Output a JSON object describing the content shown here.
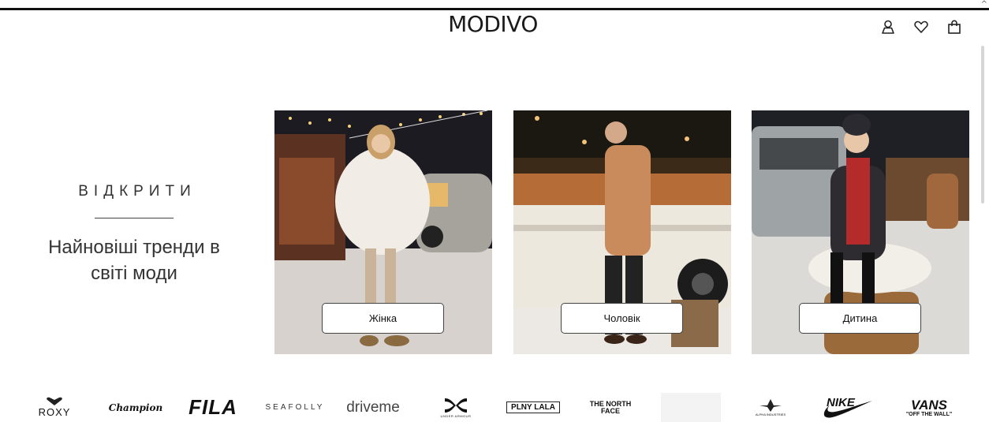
{
  "header": {
    "logo": "MODIVO",
    "icons": [
      "user-icon",
      "heart-icon",
      "bag-icon"
    ]
  },
  "promo": {
    "kicker": "ВІДКРИТИ",
    "headline_line1": "Найновіші тренди в",
    "headline_line2": "світі моди"
  },
  "categories": [
    {
      "label": "Жінка"
    },
    {
      "label": "Чоловік"
    },
    {
      "label": "Дитина"
    }
  ],
  "brands": [
    {
      "name": "ROXY"
    },
    {
      "name": "Champion"
    },
    {
      "name": "FILA"
    },
    {
      "name": "SEAFOLLY"
    },
    {
      "name": "driveme"
    },
    {
      "name": "UNDER ARMOUR"
    },
    {
      "name": "PLNY LALA"
    },
    {
      "name": "THE NORTH FACE"
    },
    {
      "name": ""
    },
    {
      "name": "ALPHA INDUSTRIES"
    },
    {
      "name": "NIKE"
    },
    {
      "name": "VANS",
      "tagline": "\"OFF THE WALL\""
    }
  ],
  "colors": {
    "text": "#222222",
    "border": "#444444",
    "night_sky": "#1b1a22"
  }
}
